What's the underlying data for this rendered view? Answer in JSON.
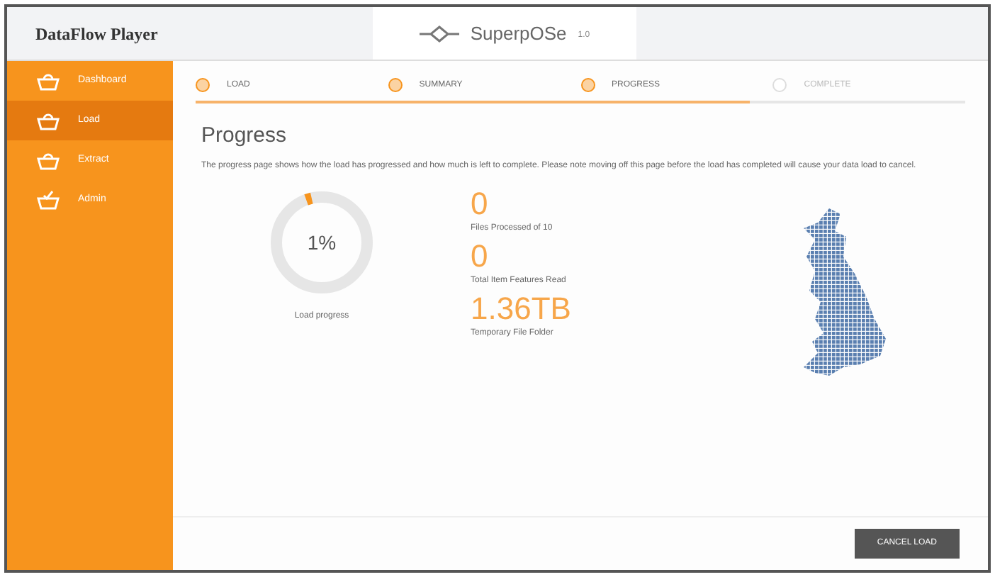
{
  "header": {
    "app_title": "DataFlow Player",
    "logo_text": "SuperpOSe",
    "logo_version": "1.0"
  },
  "sidebar": {
    "items": [
      {
        "label": "Dashboard",
        "selected": false
      },
      {
        "label": "Load",
        "selected": true
      },
      {
        "label": "Extract",
        "selected": false
      },
      {
        "label": "Admin",
        "selected": false
      }
    ]
  },
  "steps": {
    "level": 0.72,
    "items": [
      {
        "label": "LOAD",
        "done": true
      },
      {
        "label": "SUMMARY",
        "done": true
      },
      {
        "label": "PROGRESS",
        "done": true
      },
      {
        "label": "COMPLETE",
        "done": false
      }
    ]
  },
  "page": {
    "title": "Progress",
    "description": "The progress page shows how the load has progressed and how much is left to complete. Please note moving off this page before the load has completed will cause your data load to cancel."
  },
  "load_progress": {
    "reading": "1%",
    "label": "Load progress"
  },
  "stats": [
    {
      "value": "0",
      "label": "Files Processed of 10"
    },
    {
      "value": "0",
      "label": "Total Item Features Read"
    },
    {
      "value": "1.36TB",
      "label": "Temporary File Folder"
    }
  ],
  "buttons": [
    "CANCEL LOAD"
  ]
}
